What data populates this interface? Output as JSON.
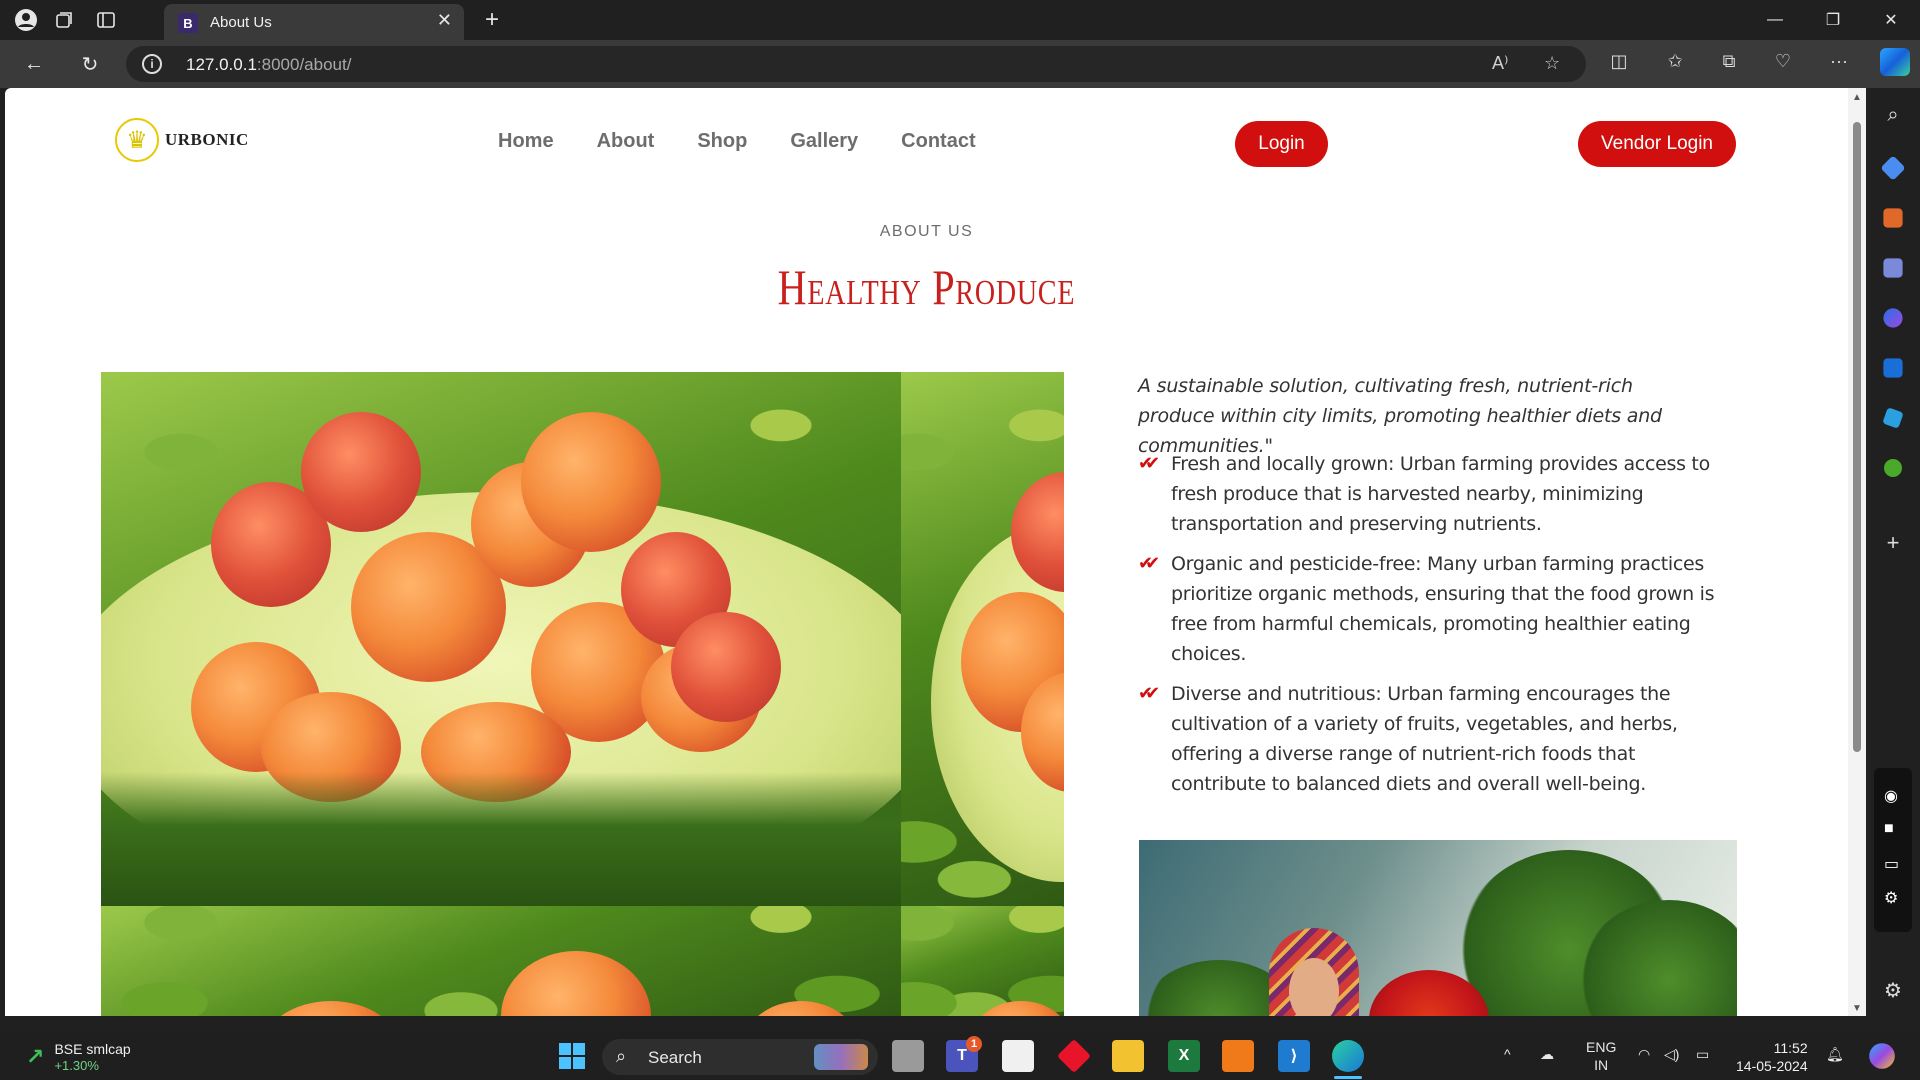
{
  "browser": {
    "tab_title": "About Us",
    "tab_favicon": "B",
    "url_host": "127.0.0.1",
    "url_path": ":8000/about/",
    "read_aloud_label": "A⁾"
  },
  "site": {
    "logo_text": "URBONIC",
    "nav": [
      "Home",
      "About",
      "Shop",
      "Gallery",
      "Contact"
    ],
    "login_label": "Login",
    "vendor_login_label": "Vendor Login",
    "accent_color": "#d10f0f"
  },
  "section": {
    "eyebrow": "ABOUT US",
    "title": "Healthy Produce",
    "intro": "A sustainable solution, cultivating fresh, nutrient-rich produce within city limits, promoting healthier diets and communities.\"",
    "bullets": [
      "Fresh and locally grown: Urban farming provides access to fresh produce that is harvested nearby, minimizing transportation and preserving nutrients.",
      "Organic and pesticide-free: Many urban farming practices prioritize organic methods, ensuring that the food grown is free from harmful chemicals, promoting healthier eating choices.",
      "Diverse and nutritious: Urban farming encourages the cultivation of a variety of fruits, vegetables, and herbs, offering a diverse range of nutrient-rich foods that contribute to balanced diets and overall well-being."
    ],
    "check_icon": "✔✔"
  },
  "taskbar": {
    "stock_name": "BSE smlcap",
    "stock_change": "+1.30%",
    "search_placeholder": "Search",
    "teams_badge": "1",
    "lang_top": "ENG",
    "lang_bottom": "IN",
    "time": "11:52",
    "date": "14-05-2024"
  }
}
